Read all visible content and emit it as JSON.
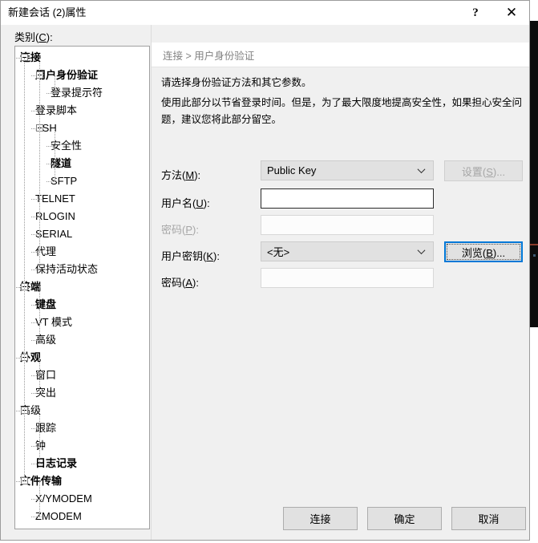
{
  "window": {
    "title": "新建会话 (2)属性",
    "help_glyph": "?",
    "close_glyph": "✕"
  },
  "category": {
    "label_pre": "类别(",
    "label_mnemonic": "C",
    "label_post": "):"
  },
  "tree": {
    "items": [
      {
        "label": "连接",
        "level": 0,
        "bold": true,
        "expander": "minus"
      },
      {
        "label": "用户身份验证",
        "level": 1,
        "bold": true,
        "expander": "minus"
      },
      {
        "label": "登录提示符",
        "level": 2,
        "bold": false,
        "expander": "none"
      },
      {
        "label": "登录脚本",
        "level": 1,
        "bold": false,
        "expander": "none"
      },
      {
        "label": "SSH",
        "level": 1,
        "bold": false,
        "expander": "minus"
      },
      {
        "label": "安全性",
        "level": 2,
        "bold": false,
        "expander": "none"
      },
      {
        "label": "隧道",
        "level": 2,
        "bold": true,
        "expander": "none"
      },
      {
        "label": "SFTP",
        "level": 2,
        "bold": false,
        "expander": "none"
      },
      {
        "label": "TELNET",
        "level": 1,
        "bold": false,
        "expander": "none"
      },
      {
        "label": "RLOGIN",
        "level": 1,
        "bold": false,
        "expander": "none"
      },
      {
        "label": "SERIAL",
        "level": 1,
        "bold": false,
        "expander": "none"
      },
      {
        "label": "代理",
        "level": 1,
        "bold": false,
        "expander": "none"
      },
      {
        "label": "保持活动状态",
        "level": 1,
        "bold": false,
        "expander": "none"
      },
      {
        "label": "终端",
        "level": 0,
        "bold": true,
        "expander": "minus"
      },
      {
        "label": "键盘",
        "level": 1,
        "bold": true,
        "expander": "none"
      },
      {
        "label": "VT 模式",
        "level": 1,
        "bold": false,
        "expander": "none"
      },
      {
        "label": "高级",
        "level": 1,
        "bold": false,
        "expander": "none"
      },
      {
        "label": "外观",
        "level": 0,
        "bold": true,
        "expander": "minus"
      },
      {
        "label": "窗口",
        "level": 1,
        "bold": false,
        "expander": "none"
      },
      {
        "label": "突出",
        "level": 1,
        "bold": false,
        "expander": "none"
      },
      {
        "label": "高级",
        "level": 0,
        "bold": false,
        "expander": "minus"
      },
      {
        "label": "跟踪",
        "level": 1,
        "bold": false,
        "expander": "none"
      },
      {
        "label": "钟",
        "level": 1,
        "bold": false,
        "expander": "none"
      },
      {
        "label": "日志记录",
        "level": 1,
        "bold": true,
        "expander": "none"
      },
      {
        "label": "文件传输",
        "level": 0,
        "bold": true,
        "expander": "minus"
      },
      {
        "label": "X/YMODEM",
        "level": 1,
        "bold": false,
        "expander": "none"
      },
      {
        "label": "ZMODEM",
        "level": 1,
        "bold": false,
        "expander": "none"
      }
    ]
  },
  "content": {
    "breadcrumb": "连接 > 用户身份验证",
    "description_line1": "请选择身份验证方法和其它参数。",
    "description_line2": "使用此部分以节省登录时间。但是，为了最大限度地提高安全性，如果担心安全问题，建议您将此部分留空。"
  },
  "form": {
    "method": {
      "label_pre": "方法(",
      "label_mnemonic": "M",
      "label_post": "):",
      "value": "Public Key"
    },
    "username": {
      "label_pre": "用户名(",
      "label_mnemonic": "U",
      "label_post": "):",
      "value": ""
    },
    "password": {
      "label_pre": "密码(",
      "label_mnemonic": "P",
      "label_post": "):",
      "value": "",
      "disabled": true
    },
    "userkey": {
      "label_pre": "用户密钥(",
      "label_mnemonic": "K",
      "label_post": "):",
      "value": "<无>"
    },
    "passphrase": {
      "label_pre": "密码(",
      "label_mnemonic": "A",
      "label_post": "):",
      "value": ""
    },
    "settings_button": {
      "label_pre": "设置(",
      "label_mnemonic": "S",
      "label_post": ")...",
      "disabled": true
    },
    "browse_button": {
      "label_pre": "浏览(",
      "label_mnemonic": "B",
      "label_post": ")...",
      "focused": true
    }
  },
  "footer": {
    "connect": "连接",
    "ok": "确定",
    "cancel": "取消"
  },
  "colors": {
    "accent_focus": "#0078d7",
    "dialog_bg": "#f0f0f0",
    "tree_bg": "#ffffff",
    "terminal_bg": "#0c0c0c"
  }
}
